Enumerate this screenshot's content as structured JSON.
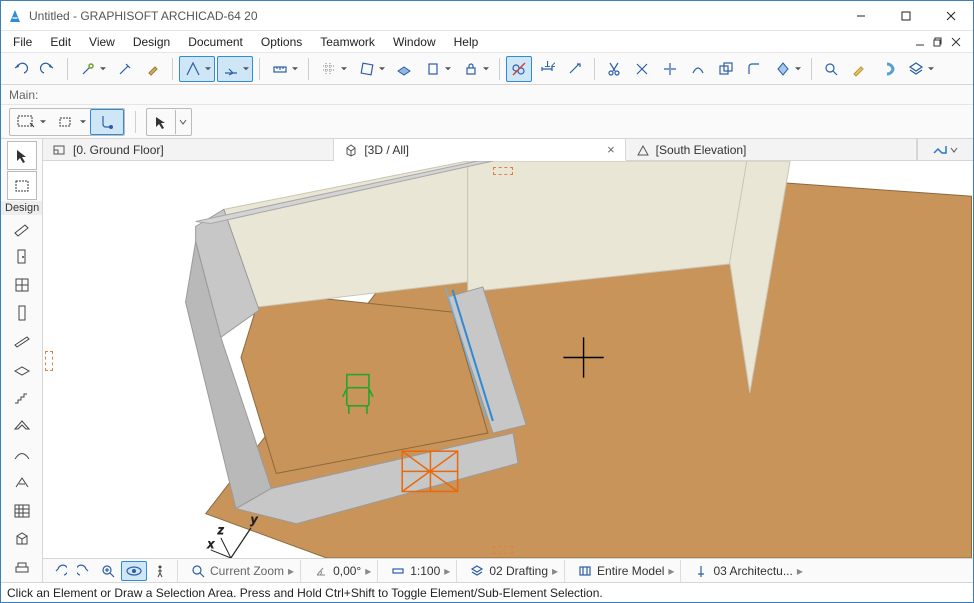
{
  "window": {
    "title": "Untitled - GRAPHISOFT ARCHICAD-64 20"
  },
  "menu": {
    "items": [
      "File",
      "Edit",
      "View",
      "Design",
      "Document",
      "Options",
      "Teamwork",
      "Window",
      "Help"
    ]
  },
  "info": {
    "label": "Main:"
  },
  "tabs": {
    "items": [
      {
        "label": "[0. Ground Floor]",
        "icon": "floorplan-icon",
        "active": false
      },
      {
        "label": "[3D / All]",
        "icon": "cube-icon",
        "active": true
      },
      {
        "label": "[South Elevation]",
        "icon": "elevation-icon",
        "active": false
      }
    ]
  },
  "toolbox": {
    "group_label": "Design"
  },
  "bottom": {
    "zoom_label": "Current Zoom",
    "angle": "0,00°",
    "scale": "1:100",
    "layer": "02 Drafting",
    "model": "Entire Model",
    "view": "03 Architectu..."
  },
  "status": {
    "text": "Click an Element or Draw a Selection Area. Press and Hold Ctrl+Shift to Toggle Element/Sub-Element Selection."
  },
  "colors": {
    "accent": "#2f8bd6",
    "floor": "#c9945a",
    "wall": "#bdbdbd",
    "wall_face": "#e9e6d6"
  }
}
